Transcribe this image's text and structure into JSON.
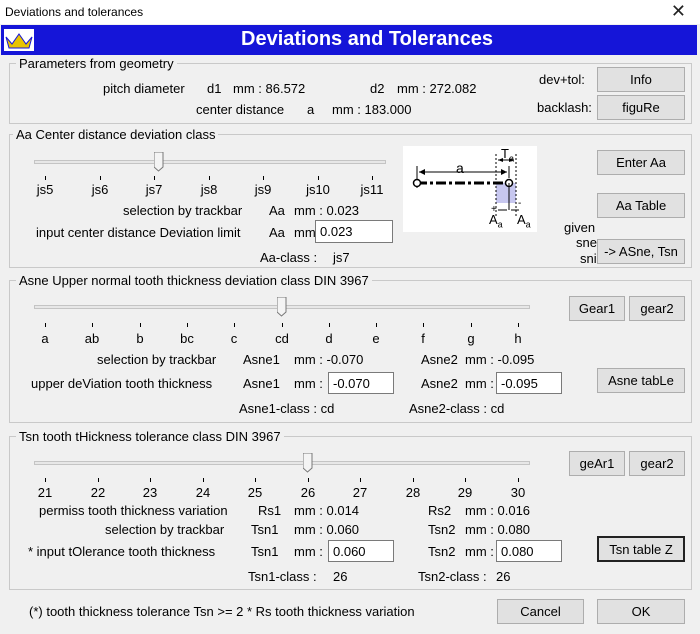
{
  "window": {
    "title": "Deviations and tolerances",
    "banner": "Deviations and Tolerances"
  },
  "params": {
    "title": "Parameters from geometry",
    "pitch_label": "pitch diameter",
    "d1_label": "d1",
    "d1_unit": "mm : 86.572",
    "d2_label": "d2",
    "d2_unit": "mm : 272.082",
    "center_label": "center distance",
    "a_label": "a",
    "a_unit": "mm : 183.000",
    "devtol_label": "dev+tol:",
    "info_btn": "Info",
    "backlash_label": "backlash:",
    "figure_btn": "figuRe"
  },
  "aa": {
    "title": "Aa  Center distance deviation class",
    "ticks": [
      "js5",
      "js6",
      "js7",
      "js8",
      "js9",
      "js10",
      "js11"
    ],
    "sel_label": "selection by trackbar",
    "sel_sym": "Aa",
    "sel_val": "mm : 0.023",
    "input_label": "input center distance Deviation limit",
    "input_sym": "Aa",
    "input_unit": "mm :",
    "input_value": "0.023",
    "class_label": "Aa-class :",
    "class_val": "js7",
    "enter_btn": "Enter  Aa",
    "table_btn": "Aa Table",
    "given_label": "given",
    "sne_label": "sne",
    "sni_label": "sni",
    "tsn_btn": "-> ASne, Tsn",
    "fig": {
      "a": "a",
      "T": "T",
      "Tsub": "a",
      "A1": "A",
      "A1sub": "a",
      "A2": "A",
      "A2sub": "a"
    },
    "slider_fraction": 0.35
  },
  "asne": {
    "title": "Asne Upper normal tooth thickness deviation class  DIN 3967",
    "ticks": [
      "a",
      "ab",
      "b",
      "bc",
      "c",
      "cd",
      "d",
      "e",
      "f",
      "g",
      "h"
    ],
    "sel_label": "selection by trackbar",
    "sel_sym1": "Asne1",
    "sel_val1": "mm : -0.070",
    "sel_sym2": "Asne2",
    "sel_val2": "mm : -0.095",
    "upper_label": "upper deViation tooth thickness",
    "in_sym1": "Asne1",
    "in_unit1": "mm :",
    "in_val1": "-0.070",
    "in_sym2": "Asne2",
    "in_unit2": "mm :",
    "in_val2": "-0.095",
    "class1": "Asne1-class : cd",
    "class2": "Asne2-class : cd",
    "gear1_btn": "Gear1",
    "gear2_btn": "gear2",
    "table_btn": "Asne tabLe",
    "slider_fraction": 0.5
  },
  "tsn": {
    "title": "Tsn tooth tHickness tolerance class  DIN 3967",
    "ticks": [
      "21",
      "22",
      "23",
      "24",
      "25",
      "26",
      "27",
      "28",
      "29",
      "30"
    ],
    "rs_label": "permiss tooth thickness variation",
    "rs1_sym": "Rs1",
    "rs1_val": "mm : 0.014",
    "rs2_sym": "Rs2",
    "rs2_val": "mm : 0.016",
    "sel_label": "selection by trackbar",
    "sel_sym1": "Tsn1",
    "sel_val1": "mm : 0.060",
    "sel_sym2": "Tsn2",
    "sel_val2": "mm : 0.080",
    "input_label": "* input tOlerance tooth thickness",
    "in_sym1": "Tsn1",
    "in_unit1": "mm :",
    "in_val1": "0.060",
    "in_sym2": "Tsn2",
    "in_unit2": "mm :",
    "in_val2": "0.080",
    "class1": "Tsn1-class :",
    "class1_val": "26",
    "class2": "Tsn2-class :",
    "class2_val": "26",
    "gear1_btn": "geAr1",
    "gear2_btn": "gear2",
    "table_btn": "Tsn table Z",
    "slider_fraction": 0.556
  },
  "footer": {
    "note": "(*) tooth thickness tolerance Tsn >= 2 * Rs tooth thickness variation",
    "cancel_btn": "Cancel",
    "ok_btn": "OK"
  }
}
